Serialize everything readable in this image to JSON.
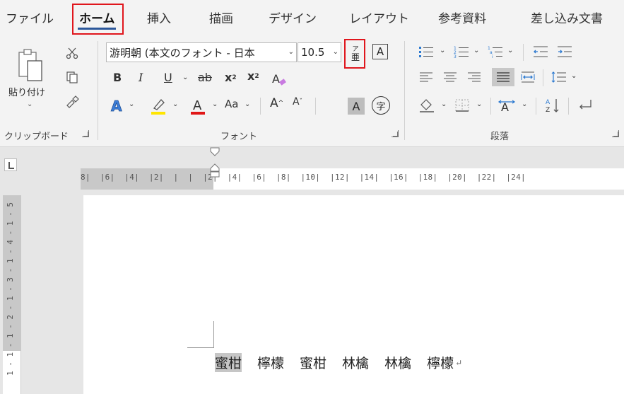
{
  "tabs": [
    "ファイル",
    "ホーム",
    "挿入",
    "描画",
    "デザイン",
    "レイアウト",
    "参考資料",
    "差し込み文書"
  ],
  "ribbon": {
    "clipboard": {
      "paste_label": "貼り付け",
      "group_label": "クリップボード"
    },
    "font": {
      "font_name": "游明朝 (本文のフォント - 日本",
      "font_size": "10.5",
      "change_case_label": "Aa",
      "phonetic_guide_glyph": "亜",
      "phonetic_guide_ruby": "ア",
      "char_border_glyph": "A",
      "char_shading_glyph": "A",
      "enclose_char_glyph": "字",
      "group_label": "フォント",
      "highlight_color": "#ffe500",
      "font_color": "#e01616"
    },
    "paragraph": {
      "group_label": "段落"
    }
  },
  "ruler": {
    "horizontal_text": "8|  |6|  |4|  |2|  |  |  |2|  |4|  |6|  |8|  |10|  |12|  |14|  |16|  |18|  |20|  |22|  |24|",
    "vertical_text": "1 - 1 - 1 - 2 - 1 - 3 - 1 - 4 - 1 - 5"
  },
  "document": {
    "words": [
      "蜜柑",
      "檸檬",
      "蜜柑",
      "林檎",
      "林檎",
      "檸檬"
    ],
    "selected_word_index": 0
  },
  "colors": {
    "accent": "#2b579a",
    "highlight_frame": "#e0161d"
  }
}
